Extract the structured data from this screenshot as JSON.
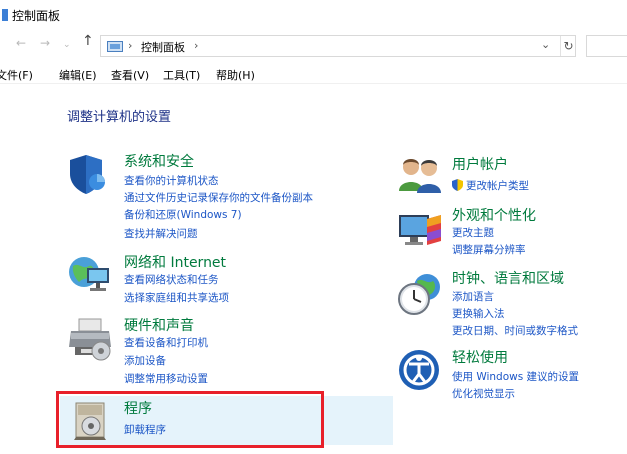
{
  "window": {
    "title": "控制面板"
  },
  "nav": {
    "back_icon": "←",
    "forward_icon": "→",
    "recent_icon": "⌄",
    "up_icon": "↑",
    "address_sep": "›",
    "address_path": "控制面板",
    "dropdown_icon": "⌄",
    "refresh_icon": "↻"
  },
  "menu": [
    {
      "label": "文件(F)"
    },
    {
      "label": "编辑(E)"
    },
    {
      "label": "查看(V)"
    },
    {
      "label": "工具(T)"
    },
    {
      "label": "帮助(H)"
    }
  ],
  "heading": "调整计算机的设置",
  "left_categories": [
    {
      "title": "系统和安全",
      "icon": "shield-icon",
      "links": [
        "查看你的计算机状态",
        "通过文件历史记录保存你的文件备份副本",
        "备份和还原(Windows 7)",
        "查找并解决问题"
      ]
    },
    {
      "title": "网络和 Internet",
      "icon": "network-icon",
      "links": [
        "查看网络状态和任务",
        "选择家庭组和共享选项"
      ]
    },
    {
      "title": "硬件和声音",
      "icon": "printer-icon",
      "links": [
        "查看设备和打印机",
        "添加设备",
        "调整常用移动设置"
      ]
    },
    {
      "title": "程序",
      "icon": "programs-icon",
      "links": [
        "卸载程序"
      ]
    }
  ],
  "right_categories": [
    {
      "title": "用户帐户",
      "icon": "users-icon",
      "links": [
        "更改帐户类型"
      ]
    },
    {
      "title": "外观和个性化",
      "icon": "appearance-icon",
      "links": [
        "更改主题",
        "调整屏幕分辨率"
      ]
    },
    {
      "title": "时钟、语言和区域",
      "icon": "clock-globe-icon",
      "links": [
        "添加语言",
        "更换输入法",
        "更改日期、时间或数字格式"
      ]
    },
    {
      "title": "轻松使用",
      "icon": "ease-of-access-icon",
      "links": [
        "使用 Windows 建议的设置",
        "优化视觉显示"
      ]
    }
  ],
  "colors": {
    "category_title": "#007a3d",
    "link": "#1c56c6",
    "heading": "#1e3287",
    "highlight_box": "#e8202a",
    "hover_bg": "#e5f3fb"
  }
}
